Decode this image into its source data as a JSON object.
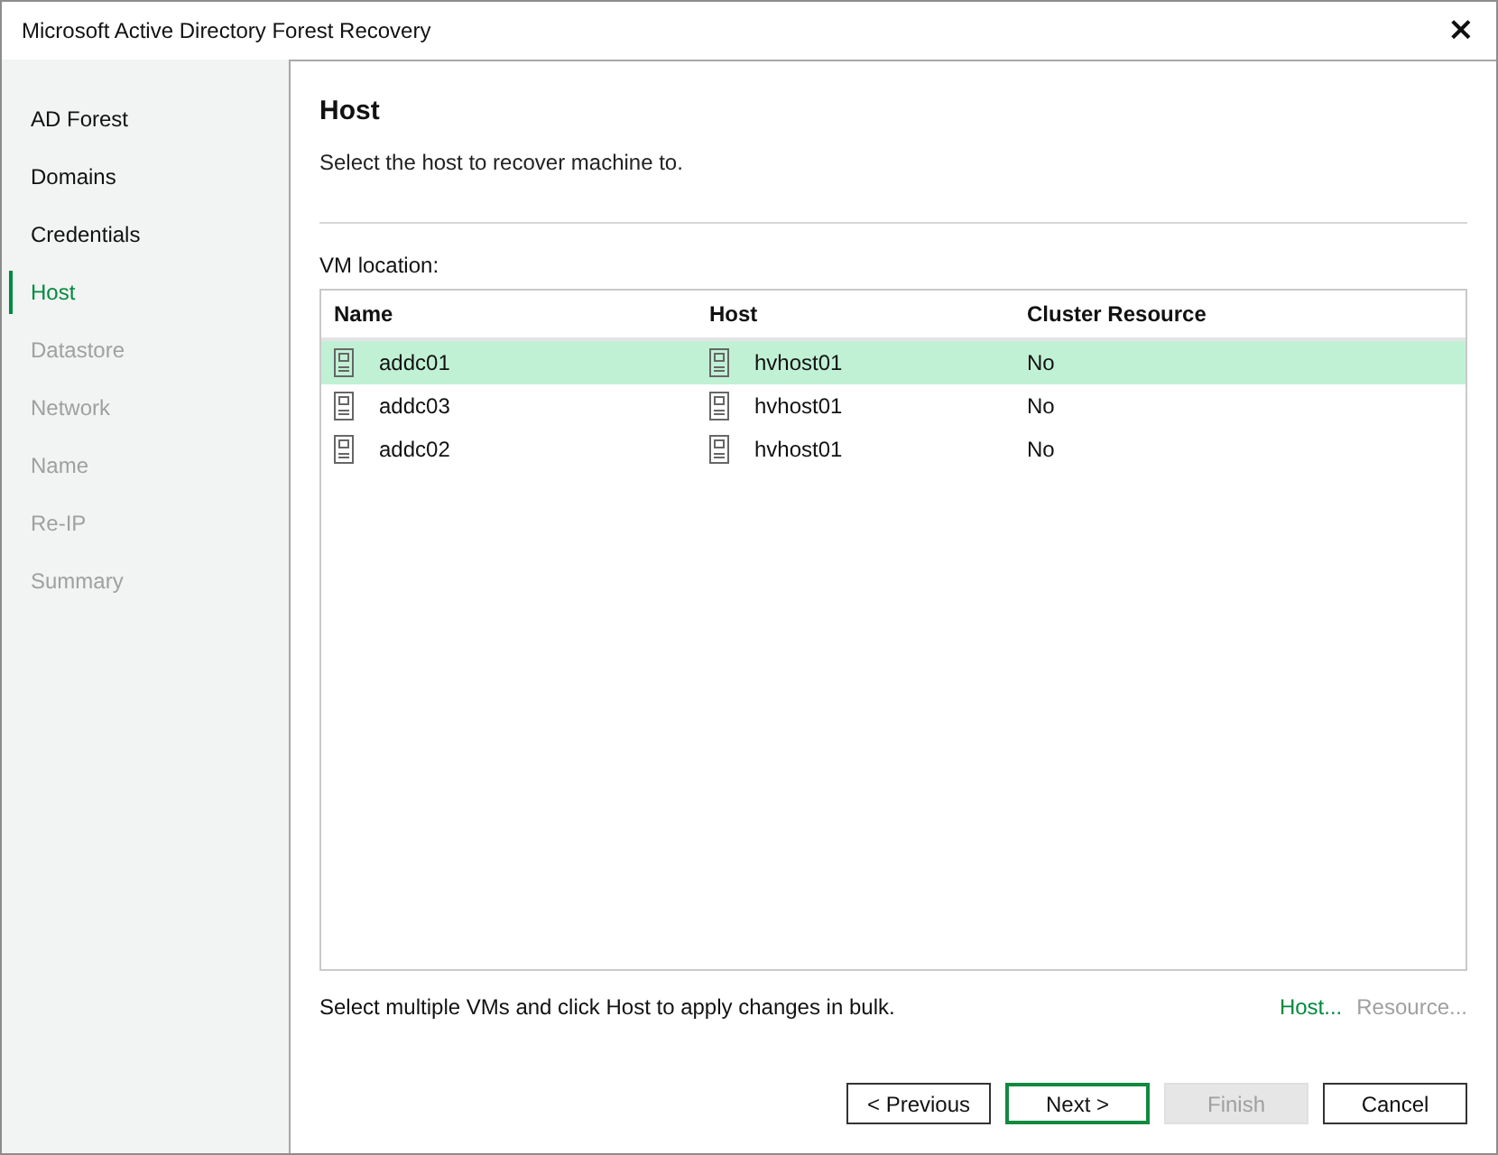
{
  "window": {
    "title": "Microsoft Active Directory Forest Recovery",
    "close": "×"
  },
  "sidebar": {
    "items": [
      {
        "label": "AD Forest",
        "selected": false,
        "disabled": false
      },
      {
        "label": "Domains",
        "selected": false,
        "disabled": false
      },
      {
        "label": "Credentials",
        "selected": false,
        "disabled": false
      },
      {
        "label": "Host",
        "selected": true,
        "disabled": false
      },
      {
        "label": "Datastore",
        "selected": false,
        "disabled": true
      },
      {
        "label": "Network",
        "selected": false,
        "disabled": true
      },
      {
        "label": "Name",
        "selected": false,
        "disabled": true
      },
      {
        "label": "Re-IP",
        "selected": false,
        "disabled": true
      },
      {
        "label": "Summary",
        "selected": false,
        "disabled": true
      }
    ]
  },
  "page": {
    "title": "Host",
    "subtitle": "Select the host to recover machine to."
  },
  "table": {
    "label": "VM location:",
    "columns": [
      "Name",
      "Host",
      "Cluster Resource"
    ],
    "rows": [
      {
        "name": "addc01",
        "host": "hvhost01",
        "cluster_resource": "No",
        "selected": true
      },
      {
        "name": "addc03",
        "host": "hvhost01",
        "cluster_resource": "No",
        "selected": false
      },
      {
        "name": "addc02",
        "host": "hvhost01",
        "cluster_resource": "No",
        "selected": false
      }
    ]
  },
  "hint": "Select multiple VMs and click Host to apply changes in bulk.",
  "links": [
    {
      "label": "Host...",
      "disabled": false
    },
    {
      "label": "Resource...",
      "disabled": true
    }
  ],
  "buttons": [
    {
      "label": "< Previous",
      "default": false,
      "disabled": false
    },
    {
      "label": "Next >",
      "default": true,
      "disabled": false
    },
    {
      "label": "Finish",
      "default": false,
      "disabled": true
    },
    {
      "label": "Cancel",
      "default": false,
      "disabled": false
    }
  ]
}
